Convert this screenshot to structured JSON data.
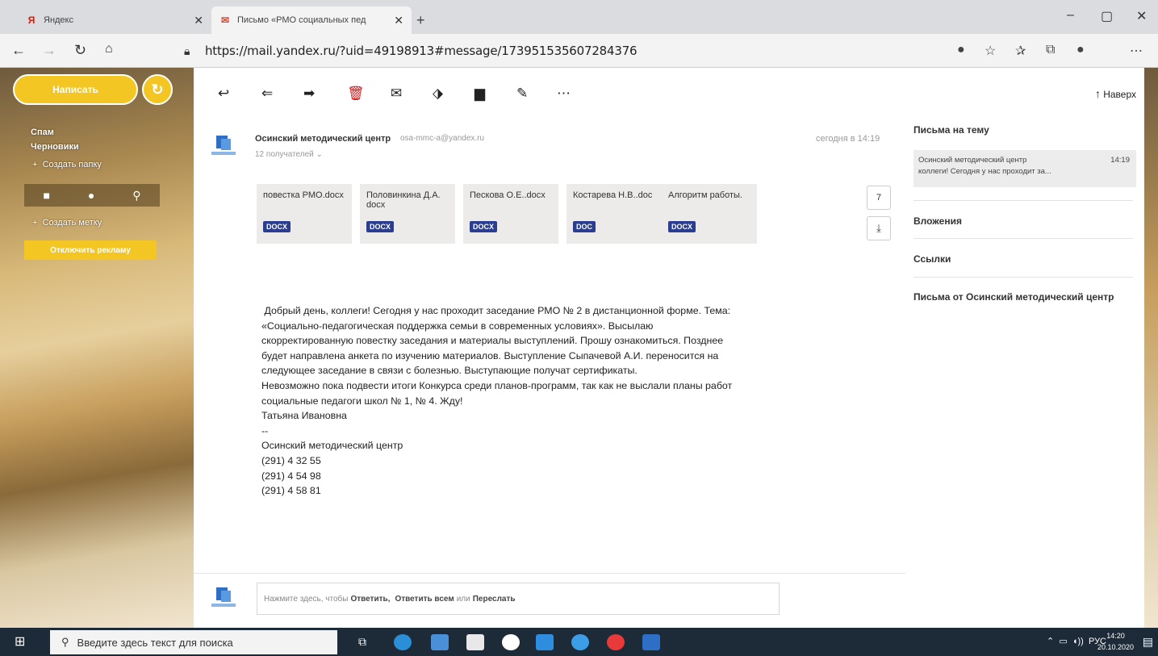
{
  "browser": {
    "tabs": [
      {
        "title": "Яндекс",
        "icon": "yandex-icon",
        "active": false
      },
      {
        "title": "Письмо «РМО социальных пед",
        "icon": "mail-icon",
        "active": true
      }
    ],
    "url": "https://mail.yandex.ru/?uid=49198913#message/173951535607284376"
  },
  "sidebar": {
    "compose_label": "Написать",
    "folders": [
      "Спам",
      "Черновики"
    ],
    "create_folder": "Создать папку",
    "create_label": "Создать метку",
    "disable_ads": "Отключить рекламу"
  },
  "toolbar": {
    "up_label": "Наверх"
  },
  "message": {
    "sender_name": "Осинский методический центр",
    "sender_email": "osa-mmc-a@yandex.ru",
    "recipients": "12 получателей",
    "date": "сегодня в 14:19",
    "attachments": [
      {
        "name": "повестка РМО.docx",
        "type": "DOCX"
      },
      {
        "name": "Половинкина Д.А. docx",
        "type": "DOCX"
      },
      {
        "name": "Пескова О.Е..docx",
        "type": "DOCX"
      },
      {
        "name": "Костарева Н.В..doc",
        "type": "DOC"
      },
      {
        "name": "Алгоритм работы.",
        "type": "DOCX"
      }
    ],
    "attachments_count": "7",
    "body_lines": [
      " Добрый день, коллеги! Сегодня у нас проходит заседание РМО № 2 в дистанционной форме. Тема:",
      "«Социально-педагогическая поддержка семьи в современных условиях». Высылаю",
      "скорректированную повестку заседания и материалы выступлений. Прошу ознакомиться. Позднее",
      "будет направлена анкета по изучению материалов. Выступление Сыпачевой А.И. переносится на",
      "следующее заседание в связи с болезнью. Выступающие получат сертификаты.",
      "Невозможно пока подвести итоги Конкурса среди планов-программ, так как не выслали планы работ",
      "социальные педагоги школ № 1, № 4. Жду!",
      "Татьяна Ивановна",
      "--",
      "Осинский методический центр",
      "(291) 4 32 55",
      "(291) 4 54 98",
      "(291) 4 58 81"
    ],
    "reply": {
      "prefix": "Нажмите здесь, чтобы",
      "reply": "Ответить,",
      "reply_all": "Ответить всем",
      "or": "или",
      "forward": "Переслать"
    }
  },
  "right_panel": {
    "thread_title": "Письма на тему",
    "thread_item": {
      "sender": "Осинский методический центр",
      "time": "14:19",
      "preview": "коллеги! Сегодня у нас проходит за..."
    },
    "attachments": "Вложения",
    "links": "Ссылки",
    "from_sender": "Письма от Осинский методический центр"
  },
  "taskbar": {
    "search_placeholder": "Введите здесь текст для поиска",
    "lang": "РУС",
    "time": "14:20",
    "date": "20.10.2020"
  },
  "colors": {
    "accent": "#f3c623",
    "badge": "#2b3d8f",
    "taskbar": "#1d2a37"
  }
}
